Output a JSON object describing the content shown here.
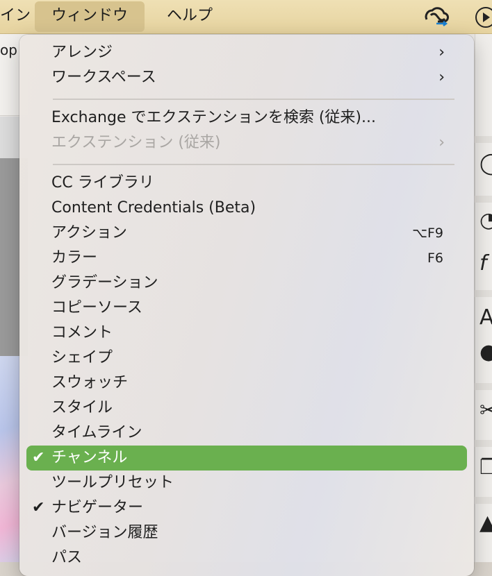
{
  "menubar": {
    "items": [
      {
        "label": "イン"
      },
      {
        "label": "ウィンドウ"
      },
      {
        "label": "ヘルプ"
      }
    ],
    "cc_icon": "creative-cloud-sync-icon",
    "play_icon": "play-circle-icon"
  },
  "app": {
    "tab_fragment": "op"
  },
  "menu": {
    "items": [
      {
        "label": "アレンジ",
        "submenu": "›"
      },
      {
        "label": "ワークスペース",
        "submenu": "›"
      },
      {
        "label": "Exchange でエクステンションを検索 (従来)..."
      },
      {
        "label": "エクステンション (従来)",
        "submenu": "›"
      },
      {
        "label": "CC ライブラリ"
      },
      {
        "label": "Content Credentials (Beta)"
      },
      {
        "label": "アクション",
        "shortcut": "⌥F9"
      },
      {
        "label": "カラー",
        "shortcut": "F6"
      },
      {
        "label": "グラデーション"
      },
      {
        "label": "コピーソース"
      },
      {
        "label": "コメント"
      },
      {
        "label": "シェイプ"
      },
      {
        "label": "スウォッチ"
      },
      {
        "label": "スタイル"
      },
      {
        "label": "タイムライン"
      },
      {
        "label": "チャンネル",
        "check": "✔"
      },
      {
        "label": "ツールプリセット"
      },
      {
        "label": "ナビゲーター",
        "check": "✔"
      },
      {
        "label": "バージョン履歴"
      },
      {
        "label": "パス"
      }
    ],
    "highlight_color": "#6ab04f"
  },
  "right_panel": {
    "icons": [
      "ellipse-icon",
      "brush-icon",
      "fx-icon",
      "type-icon",
      "dot-icon",
      "tools-icon",
      "copy-icon",
      "arrow-icon"
    ]
  }
}
